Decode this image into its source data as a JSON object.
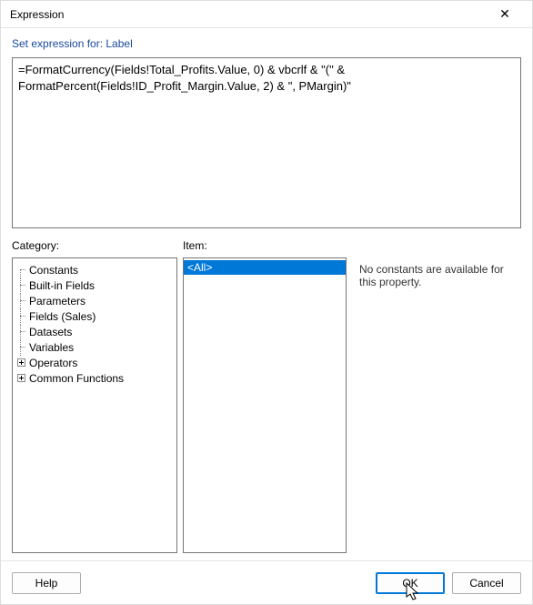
{
  "window": {
    "title": "Expression",
    "close_glyph": "✕"
  },
  "header": {
    "set_for_label": "Set expression for: Label"
  },
  "expression": {
    "value": "=FormatCurrency(Fields!Total_Profits.Value, 0) & vbcrlf & \"(\" & FormatPercent(Fields!ID_Profit_Margin.Value, 2) & \", PMargin)\""
  },
  "labels": {
    "category": "Category:",
    "item": "Item:"
  },
  "category_tree": [
    {
      "label": "Constants",
      "expandable": false
    },
    {
      "label": "Built-in Fields",
      "expandable": false
    },
    {
      "label": "Parameters",
      "expandable": false
    },
    {
      "label": "Fields (Sales)",
      "expandable": false
    },
    {
      "label": "Datasets",
      "expandable": false
    },
    {
      "label": "Variables",
      "expandable": false
    },
    {
      "label": "Operators",
      "expandable": true
    },
    {
      "label": "Common Functions",
      "expandable": true
    }
  ],
  "items": [
    {
      "label": "<All>",
      "selected": true
    }
  ],
  "description": "No constants are available for this property.",
  "buttons": {
    "help": "Help",
    "ok": "OK",
    "cancel": "Cancel"
  }
}
